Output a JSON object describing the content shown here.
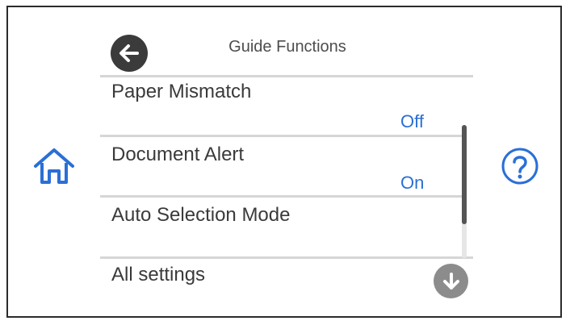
{
  "header": {
    "title": "Guide Functions"
  },
  "items": [
    {
      "label": "Paper Mismatch",
      "value": "Off"
    },
    {
      "label": "Document Alert",
      "value": "On"
    },
    {
      "label": "Auto Selection Mode",
      "value": ""
    }
  ],
  "footer": {
    "all_settings_label": "All settings"
  },
  "colors": {
    "value_text": "#2a6fd6",
    "button_dark": "#3b3b3b",
    "button_gray": "#8c8c8c",
    "home_icon": "#2a6fd6"
  },
  "icons": {
    "back": "arrow-left-icon",
    "home": "home-icon",
    "help": "question-circle-icon",
    "down": "arrow-down-icon"
  }
}
